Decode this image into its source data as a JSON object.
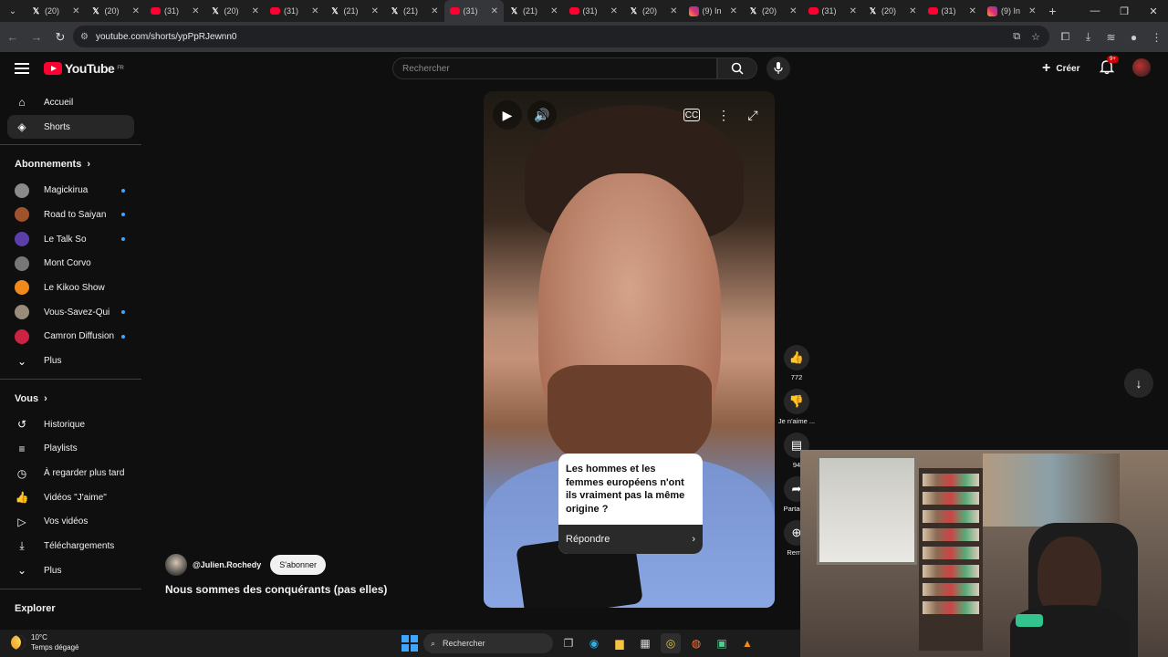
{
  "browser": {
    "tabs": [
      {
        "icon": "x",
        "label": "(20)"
      },
      {
        "icon": "x",
        "label": "(20)"
      },
      {
        "icon": "yt",
        "label": "(31)"
      },
      {
        "icon": "x",
        "label": "(20)"
      },
      {
        "icon": "yt",
        "label": "(31)"
      },
      {
        "icon": "x",
        "label": "(21)"
      },
      {
        "icon": "x",
        "label": "(21)"
      },
      {
        "icon": "yt",
        "label": "(31)",
        "active": true
      },
      {
        "icon": "x",
        "label": "(21)"
      },
      {
        "icon": "yt",
        "label": "(31)"
      },
      {
        "icon": "x",
        "label": "(20)"
      },
      {
        "icon": "ig",
        "label": "(9) In"
      },
      {
        "icon": "x",
        "label": "(20)"
      },
      {
        "icon": "yt",
        "label": "(31)"
      },
      {
        "icon": "x",
        "label": "(20)"
      },
      {
        "icon": "yt",
        "label": "(31)"
      },
      {
        "icon": "ig",
        "label": "(9) In"
      }
    ],
    "url": "youtube.com/shorts/ypPpRJewnn0"
  },
  "youtube": {
    "logo_text": "YouTube",
    "region": "FR",
    "search_placeholder": "Rechercher",
    "create_label": "Créer",
    "notif_badge": "9+"
  },
  "sidebar": {
    "main": [
      {
        "icon": "home-icon",
        "glyph": "⌂",
        "label": "Accueil"
      },
      {
        "icon": "shorts-icon",
        "glyph": "◈",
        "label": "Shorts",
        "active": true
      }
    ],
    "subs_heading": "Abonnements",
    "subs": [
      {
        "label": "Magickirua",
        "color": "#8a8a8a",
        "dot": true
      },
      {
        "label": "Road to Saiyan",
        "color": "#a0522d",
        "dot": true
      },
      {
        "label": "Le Talk So",
        "color": "#5b3fa8",
        "dot": true
      },
      {
        "label": "Mont Corvo",
        "color": "#777777",
        "dot": false
      },
      {
        "label": "Le Kikoo Show",
        "color": "#f08a1c",
        "dot": false
      },
      {
        "label": "Vous-Savez-Qui",
        "color": "#9a8c7a",
        "dot": true
      },
      {
        "label": "Camron Diffusion",
        "color": "#cc2244",
        "dot": true
      }
    ],
    "subs_more": "Plus",
    "you_heading": "Vous",
    "you": [
      {
        "icon": "history-icon",
        "glyph": "↺",
        "label": "Historique"
      },
      {
        "icon": "playlists-icon",
        "glyph": "≡",
        "label": "Playlists"
      },
      {
        "icon": "watch-later-icon",
        "glyph": "◷",
        "label": "À regarder plus tard"
      },
      {
        "icon": "liked-icon",
        "glyph": "👍",
        "label": "Vidéos \"J'aime\""
      },
      {
        "icon": "your-videos-icon",
        "glyph": "▷",
        "label": "Vos vidéos"
      },
      {
        "icon": "downloads-icon",
        "glyph": "⤓",
        "label": "Téléchargements"
      }
    ],
    "you_more": "Plus",
    "explore_heading": "Explorer"
  },
  "short": {
    "question": "Les hommes et les femmes européens n'ont ils vraiment pas la même origine ?",
    "reply_label": "Répondre",
    "channel": "@Julien.Rochedy",
    "subscribe_label": "S'abonner",
    "title": "Nous sommes des conquérants (pas elles)",
    "like_count": "772",
    "dislike_label": "Je n'aime ...",
    "comment_count": "94",
    "share_label": "Partager",
    "remix_label": "Remix"
  },
  "taskbar": {
    "temp": "10°C",
    "weather": "Temps dégagé",
    "search_label": "Rechercher"
  }
}
